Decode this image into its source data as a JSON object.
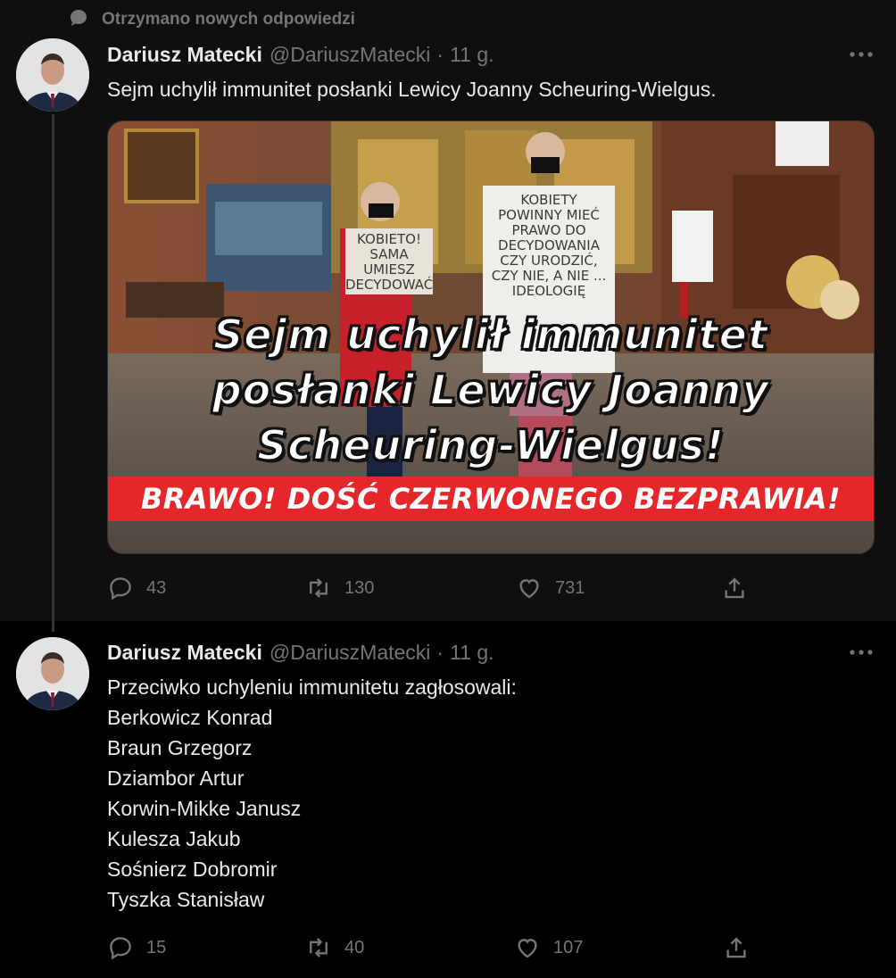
{
  "context": {
    "label": "Otrzymano nowych odpowiedzi",
    "icon": "speech-bubble-icon"
  },
  "tweets": [
    {
      "author_name": "Dariusz Matecki",
      "author_handle": "@DariuszMatecki",
      "separator": "·",
      "time": "11 g.",
      "text_lines": [
        "Sejm uchylił immunitet posłanki Lewicy Joanny Scheuring-Wielgus."
      ],
      "media": {
        "headline_lines": [
          "Sejm uchylił immunitet",
          "posłanki Lewicy Joanny",
          "Scheuring-Wielgus!"
        ],
        "banner": "BRAWO! DOŚĆ CZERWONEGO BEZPRAWIA!",
        "sign_left": "KOBIETO! SAMA UMIESZ DECYDOWAĆ",
        "sign_right": "KOBIETY POWINNY MIEĆ PRAWO DO DECYDOWANIA CZY URODZIĆ, CZY NIE, A NIE ... IDEOLOGIĘ"
      },
      "stats": {
        "replies": "43",
        "retweets": "130",
        "likes": "731"
      }
    },
    {
      "author_name": "Dariusz Matecki",
      "author_handle": "@DariuszMatecki",
      "separator": "·",
      "time": "11 g.",
      "text_lines": [
        "Przeciwko uchyleniu immunitetu zagłosowali:",
        "Berkowicz Konrad",
        "Braun Grzegorz",
        "Dziambor Artur",
        "Korwin-Mikke Janusz",
        "Kulesza Jakub",
        "Sośnierz Dobromir",
        "Tyszka Stanisław"
      ],
      "stats": {
        "replies": "15",
        "retweets": "40",
        "likes": "107"
      }
    }
  ],
  "colors": {
    "background": "#000000",
    "top_panel": "#0f0f0f",
    "text": "#e7e9ea",
    "muted": "#71767b",
    "banner_red": "#e5262b"
  }
}
